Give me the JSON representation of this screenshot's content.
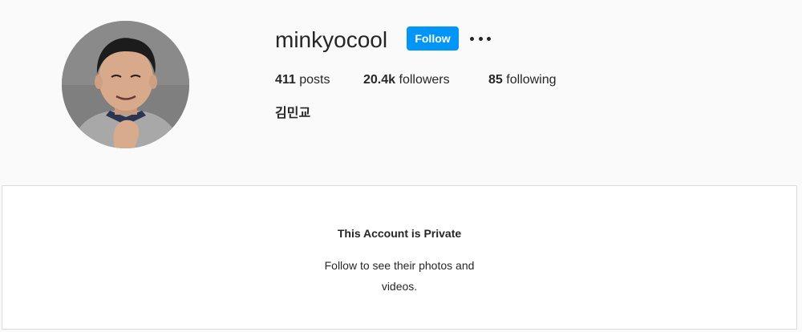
{
  "profile": {
    "username": "minkyocool",
    "follow_label": "Follow",
    "more_icon": "more-options-icon",
    "avatar_icon": "profile-photo",
    "full_name": "김민교",
    "stats": {
      "posts_count": "411",
      "posts_label": " posts",
      "followers_count": "20.4k",
      "followers_label": " followers",
      "following_count": "85",
      "following_label": " following"
    }
  },
  "private_notice": {
    "title": "This Account is Private",
    "description": "Follow to see their photos and videos."
  },
  "colors": {
    "accent": "#0095f6",
    "background": "#fafafa",
    "panel": "#ffffff",
    "border": "#dbdbdb",
    "text": "#262626"
  }
}
